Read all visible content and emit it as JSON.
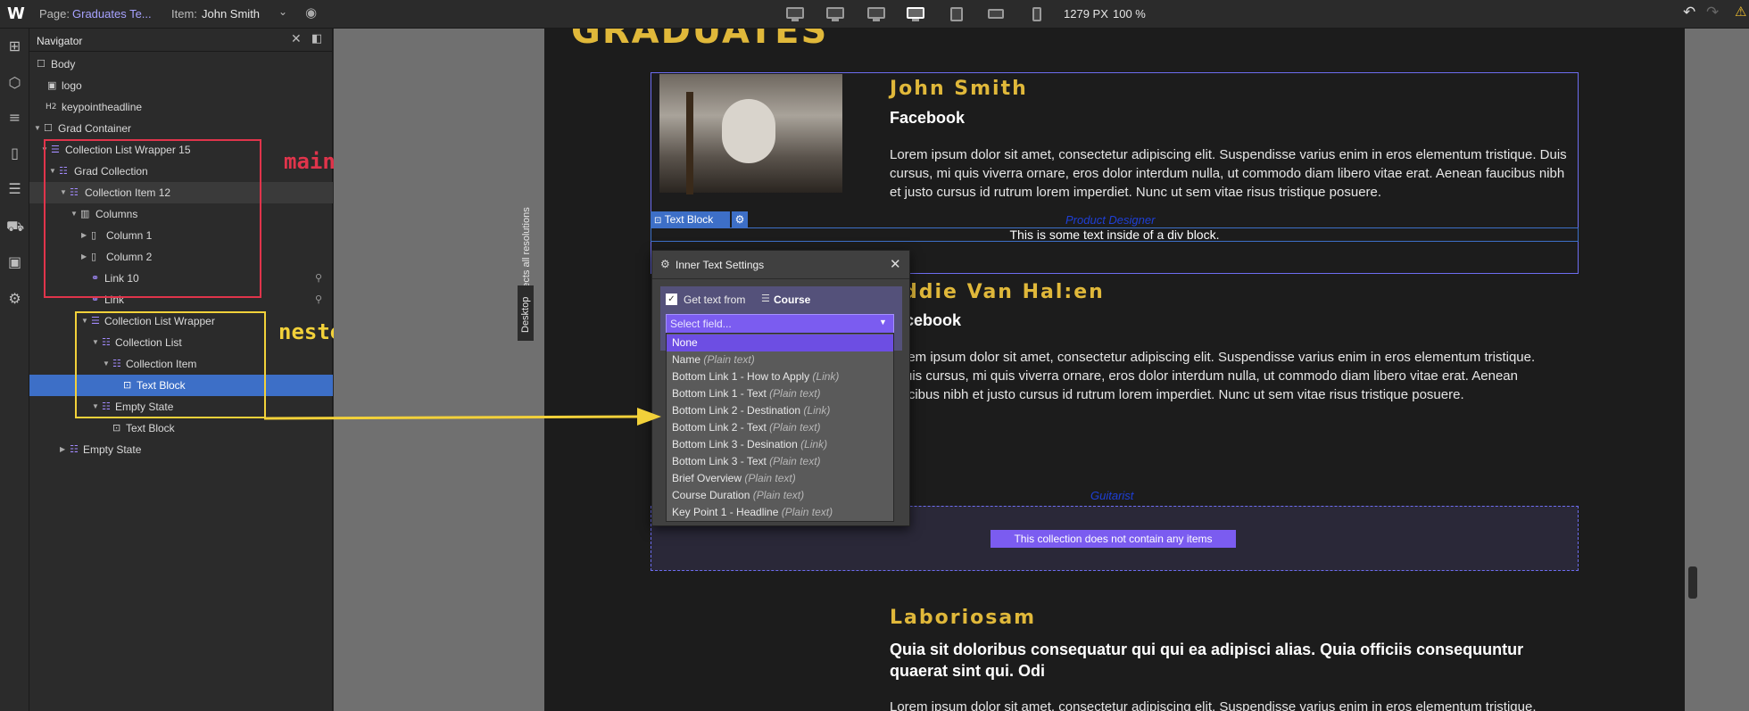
{
  "topbar": {
    "page_label": "Page:",
    "page_value": "Graduates Te...",
    "item_label": "Item:",
    "item_value": "John Smith",
    "canvas_width": "1279 PX",
    "zoom": "100 %"
  },
  "navigator": {
    "title": "Navigator",
    "rows": [
      {
        "label": "Body"
      },
      {
        "label": "logo"
      },
      {
        "label": "keypointheadline"
      },
      {
        "label": "Grad Container"
      },
      {
        "label": "Collection List Wrapper 15"
      },
      {
        "label": "Grad Collection"
      },
      {
        "label": "Collection Item 12"
      },
      {
        "label": "Columns"
      },
      {
        "label": "Column 1"
      },
      {
        "label": "Column 2"
      },
      {
        "label": "Link 10"
      },
      {
        "label": "Link"
      },
      {
        "label": "Collection List Wrapper"
      },
      {
        "label": "Collection List"
      },
      {
        "label": "Collection Item"
      },
      {
        "label": "Text Block"
      },
      {
        "label": "Empty State"
      },
      {
        "label": "Text Block"
      },
      {
        "label": "Empty State"
      }
    ]
  },
  "annotations": {
    "main": "main Collection",
    "nested": "nested Collection"
  },
  "canvas": {
    "side_label_all": "Affects all resolutions",
    "side_label_desktop": "Desktop",
    "heading_top": "GRADUATES",
    "cards": [
      {
        "name": "John Smith",
        "company": "Facebook",
        "body": "Lorem ipsum dolor sit amet, consectetur adipiscing elit. Suspendisse varius enim in eros elementum tristique. Duis cursus, mi quis viverra ornare, eros dolor interdum nulla, ut commodo diam libero vitae erat. Aenean faucibus nibh et justo cursus id rutrum lorem imperdiet. Nunc ut sem vitae risus tristique posuere.",
        "role": "Product Designer"
      },
      {
        "name": "ddie Van Hal:en",
        "company": "cebook",
        "body_lines": [
          "lem ipsum dolor sit amet, consectetur adipiscing elit. Suspendisse varius enim in eros elementum tristique.",
          "uis cursus, mi quis viverra ornare, eros dolor interdum nulla, ut commodo diam libero vitae erat. Aenean",
          "faucibus nibh et justo cursus id rutrum lorem imperdiet. Nunc ut sem vitae risus tristique posuere."
        ],
        "role": "Guitarist"
      },
      {
        "name": "Laboriosam",
        "company": "Quia sit doloribus consequatur qui qui ea adipisci alias. Quia officiis consequuntur quaerat sint qui. Odi",
        "body": "Lorem ipsum dolor sit amet, consectetur adipiscing elit. Suspendisse varius enim in eros elementum tristique."
      }
    ],
    "text_block_tag": "Text Block",
    "div_text": "This is some text inside of a div block.",
    "empty_msg": "This collection does not contain any items"
  },
  "dialog": {
    "title": "Inner Text Settings",
    "get_text_label": "Get text from",
    "source": "Course",
    "select_placeholder": "Select field...",
    "options": [
      {
        "name": "None",
        "type": ""
      },
      {
        "name": "Name",
        "type": "(Plain text)"
      },
      {
        "name": "Bottom Link 1 - How to Apply",
        "type": "(Link)"
      },
      {
        "name": "Bottom Link 1 - Text",
        "type": "(Plain text)"
      },
      {
        "name": "Bottom Link 2 - Destination",
        "type": "(Link)"
      },
      {
        "name": "Bottom Link 2 - Text",
        "type": "(Plain text)"
      },
      {
        "name": "Bottom Link 3 - Desination",
        "type": "(Link)"
      },
      {
        "name": "Bottom Link 3 - Text",
        "type": "(Plain text)"
      },
      {
        "name": "Brief Overview",
        "type": "(Plain text)"
      },
      {
        "name": "Course Duration",
        "type": "(Plain text)"
      },
      {
        "name": "Key Point 1 - Headline",
        "type": "(Plain text)"
      }
    ]
  },
  "colors": {
    "accent": "#6d4ee3",
    "selection": "#3d6fc7",
    "main_box": "#e0344b",
    "nested_box": "#f2d13a",
    "gold": "#e0b83a"
  }
}
